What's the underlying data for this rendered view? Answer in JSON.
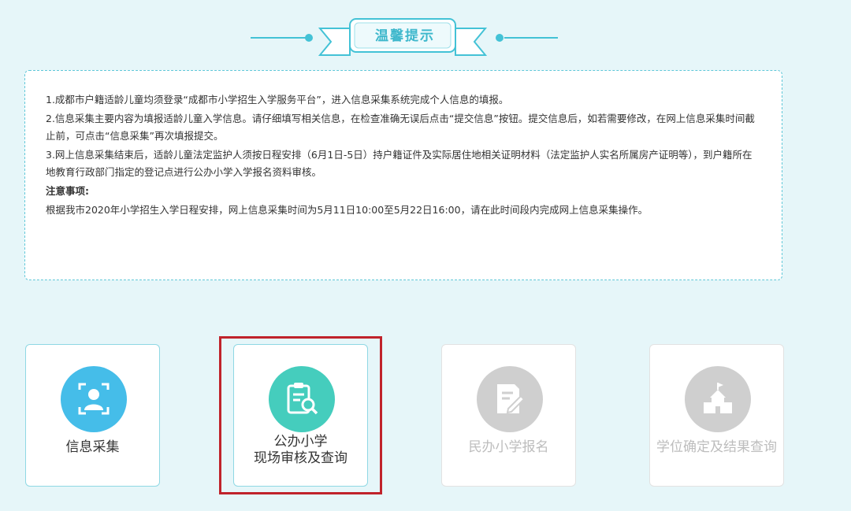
{
  "header": {
    "title": "温馨提示"
  },
  "notice": {
    "items": [
      "1.成都市户籍适龄儿童均须登录“成都市小学招生入学服务平台”，进入信息采集系统完成个人信息的填报。",
      "2.信息采集主要内容为填报适龄儿童入学信息。请仔细填写相关信息，在检查准确无误后点击“提交信息”按钮。提交信息后，如若需要修改，在网上信息采集时间截止前，可点击“信息采集”再次填报提交。",
      "3.网上信息采集结束后，适龄儿童法定监护人须按日程安排（6月1日-5日）持户籍证件及实际居住地相关证明材料（法定监护人实名所属房产证明等），到户籍所在地教育行政部门指定的登记点进行公办小学入学报名资料审核。"
    ],
    "note_title": "注意事项:",
    "note_text": "根据我市2020年小学招生入学日程安排，网上信息采集时间为5月11日10:00至5月22日16:00，请在此时间段内完成网上信息采集操作。"
  },
  "cards": [
    {
      "label": "信息采集",
      "icon": "person-scan-icon",
      "state": "active",
      "color": "#45bde9"
    },
    {
      "label_line1": "公办小学",
      "label_line2": "现场审核及查询",
      "icon": "clipboard-search-icon",
      "state": "active",
      "color": "#45cdbd"
    },
    {
      "label": "民办小学报名",
      "icon": "form-edit-icon",
      "state": "disabled",
      "color": "#cfcfcf"
    },
    {
      "label": "学位确定及结果查询",
      "icon": "school-icon",
      "state": "disabled",
      "color": "#cfcfcf"
    }
  ],
  "colors": {
    "accent": "#43c2d6",
    "highlight": "#c0232b",
    "background": "#e6f6f9"
  }
}
